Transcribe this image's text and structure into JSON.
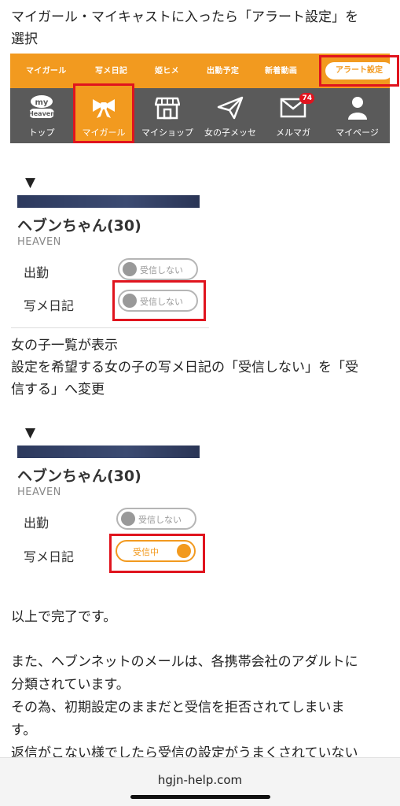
{
  "intro": {
    "line1": "マイガール・マイキャストに入ったら「アラート設定」を",
    "line2": "選択"
  },
  "orange_tabs": {
    "tab1": "マイガール",
    "tab2": "写メ日記",
    "tab3": "姫ヒメ",
    "tab4": "出勤予定",
    "tab5": "新着動画",
    "alert_settings": "アラート設定"
  },
  "nav": {
    "top_logo": "my Heaven",
    "top": "トップ",
    "my_girl": "マイガール",
    "my_shop": "マイショップ",
    "girl_message": "女の子メッセ",
    "mail_magazine": "メルマガ",
    "mail_badge": "74",
    "my_page": "マイページ"
  },
  "arrow": "▼",
  "card1": {
    "name": "ヘブンちゃん(30)",
    "shop": "HEAVEN",
    "attendance_label": "出勤",
    "attendance_toggle": "受信しない",
    "diary_label": "写メ日記",
    "diary_toggle": "受信しない"
  },
  "middle": {
    "line1": "女の子一覧が表示",
    "line2": "設定を希望する女の子の写メ日記の「受信しない」を「受",
    "line3": "信する」へ変更"
  },
  "card2": {
    "name": "ヘブンちゃん(30)",
    "shop": "HEAVEN",
    "attendance_label": "出勤",
    "attendance_toggle": "受信しない",
    "diary_label": "写メ日記",
    "diary_toggle": "受信中"
  },
  "footer_text": {
    "done": "以上で完了です。",
    "line1": "また、ヘブンネットのメールは、各携帯会社のアダルトに",
    "line2": "分類されています。",
    "line3": "その為、初期設定のままだと受信を拒否されてしまいま",
    "line4": "す。",
    "line5": "返信がこない様でしたら受信の設定がうまくされていない"
  },
  "browser": {
    "url": "hgjn-help.com"
  },
  "colors": {
    "accent": "#f29a1f",
    "highlight": "#e0141e",
    "nav_bg": "#5a5a5a"
  }
}
